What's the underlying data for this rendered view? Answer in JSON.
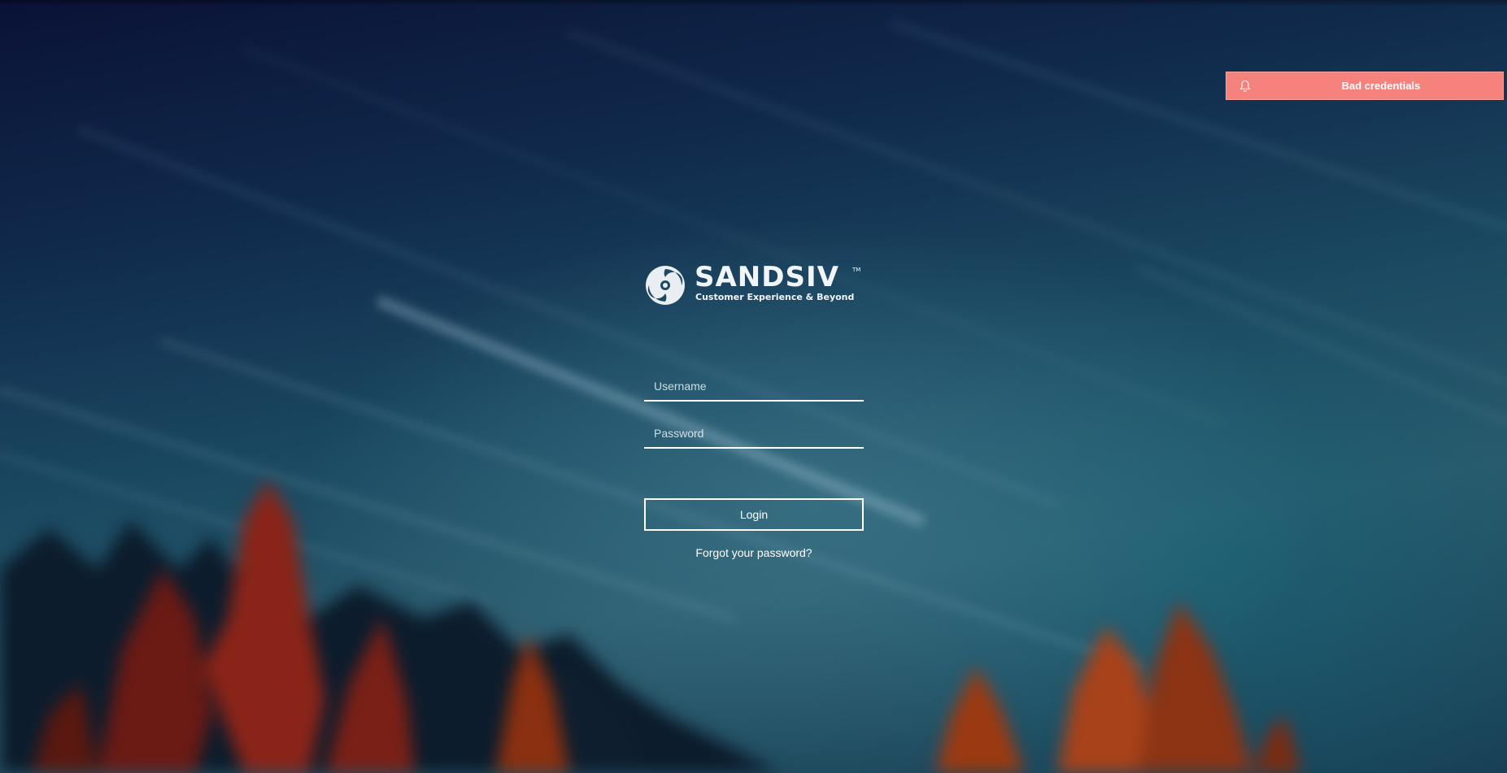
{
  "brand": {
    "name": "SANDSIV",
    "trademark": "TM",
    "tagline": "Customer Experience & Beyond",
    "logo_icon": "sandsiv-swirl-icon"
  },
  "login_form": {
    "username_placeholder": "Username",
    "password_placeholder": "Password",
    "login_label": "Login",
    "forgot_password_label": "Forgot your password?"
  },
  "notification": {
    "icon": "bell-icon",
    "message": "Bad credentials",
    "color": "#f6827d"
  }
}
